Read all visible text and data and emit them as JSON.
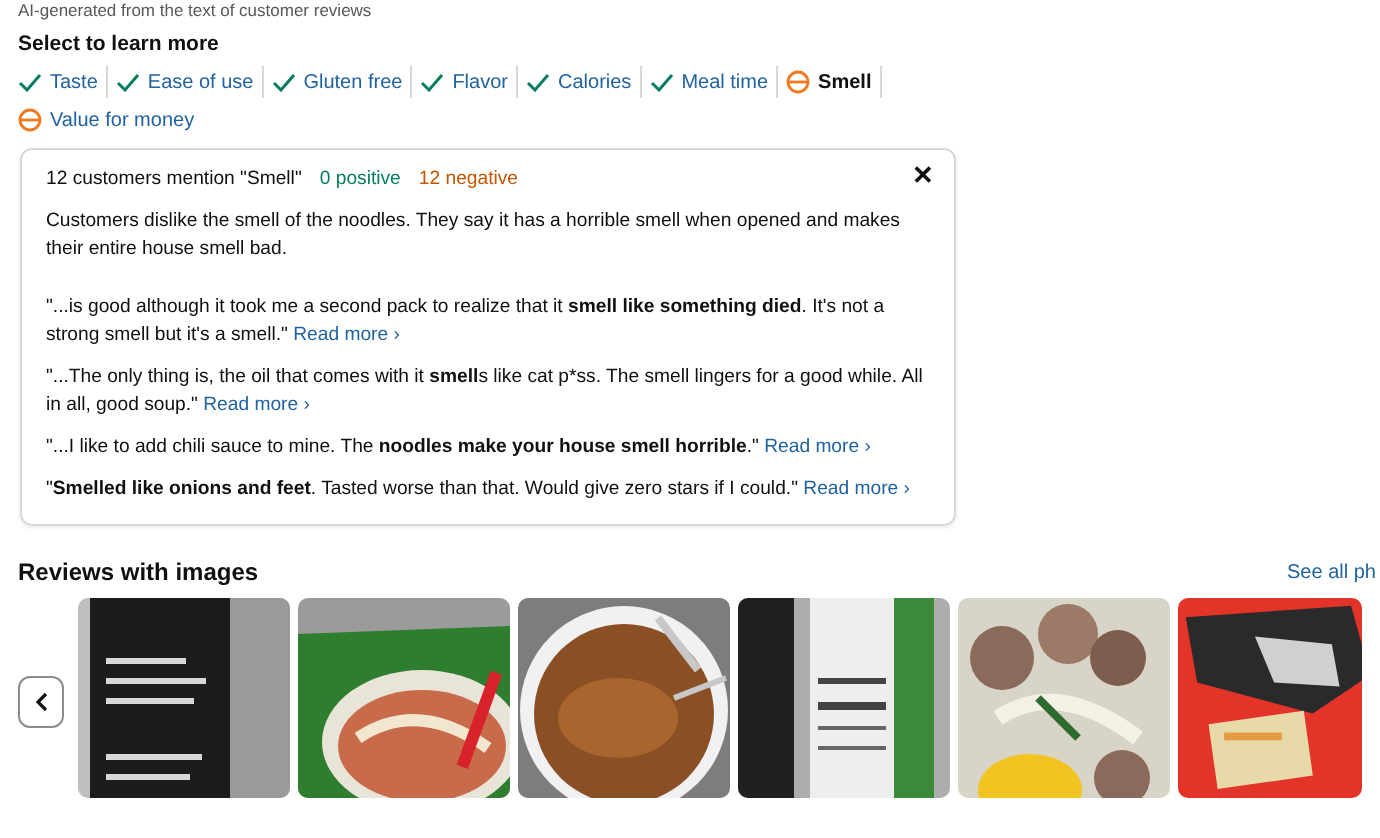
{
  "caption": "AI-generated from the text of customer reviews",
  "topics_heading": "Select to learn more",
  "topics": [
    {
      "label": "Taste",
      "kind": "positive",
      "selected": false
    },
    {
      "label": "Ease of use",
      "kind": "positive",
      "selected": false
    },
    {
      "label": "Gluten free",
      "kind": "positive",
      "selected": false
    },
    {
      "label": "Flavor",
      "kind": "positive",
      "selected": false
    },
    {
      "label": "Calories",
      "kind": "positive",
      "selected": false
    },
    {
      "label": "Meal time",
      "kind": "positive",
      "selected": false
    },
    {
      "label": "Smell",
      "kind": "mixed",
      "selected": true
    },
    {
      "label": "Value for money",
      "kind": "mixed",
      "selected": false
    }
  ],
  "panel": {
    "mention": "12 customers mention \"Smell\"",
    "positive": "0 positive",
    "negative": "12 negative",
    "close": "✕",
    "summary": "Customers dislike the smell of the noodles. They say it has a horrible smell when opened and makes their entire house smell bad.",
    "quotes": [
      {
        "text": "\"...is good although it took me a second pack to realize that it **smell like something died**. It's not a strong smell but it's a smell.\"",
        "link": "Read more ›"
      },
      {
        "text": "\"...The only thing is, the oil that comes with it **smell**s like cat p*ss. The smell lingers for a good while. All in all, good soup.\"",
        "link": "Read more ›"
      },
      {
        "text": "\"...I like to add chili sauce to mine. The **noodles make your house smell horrible**.\"",
        "link": "Read more ›"
      },
      {
        "text": "\"**Smelled like onions and feet**. Tasted worse than that. Would give zero stars if I could.\"",
        "link": "Read more ›"
      }
    ]
  },
  "reviews_images": {
    "heading": "Reviews with images",
    "see_all": "See all ph"
  }
}
